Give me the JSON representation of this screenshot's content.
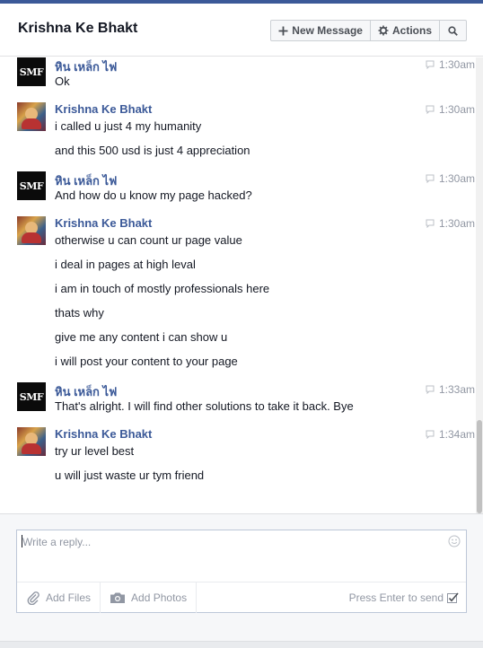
{
  "header": {
    "title": "Krishna Ke Bhakt",
    "new_message_label": "New Message",
    "actions_label": "Actions",
    "icons": {
      "new_message": "plus-icon",
      "actions": "gear-icon",
      "search": "search-icon"
    }
  },
  "messages": [
    {
      "sender": "หิน เหล็ก ไฟ",
      "avatar": "SMF",
      "time": "1:30am",
      "lines": [
        "Ok"
      ]
    },
    {
      "sender": "Krishna Ke Bhakt",
      "avatar": "krishna-avatar",
      "time": "1:30am",
      "lines": [
        "i called u just 4 my humanity",
        "and this 500 usd is just 4 appreciation"
      ]
    },
    {
      "sender": "หิน เหล็ก ไฟ",
      "avatar": "SMF",
      "time": "1:30am",
      "lines": [
        "And how do u know my page hacked?"
      ]
    },
    {
      "sender": "Krishna Ke Bhakt",
      "avatar": "krishna-avatar",
      "time": "1:30am",
      "lines": [
        "otherwise u can count ur  page value",
        "i deal in pages at high leval",
        "i am in touch of mostly professionals here",
        "thats why",
        "give me any content i can show u",
        "i will post your content to your page"
      ]
    },
    {
      "sender": "หิน เหล็ก ไฟ",
      "avatar": "SMF",
      "time": "1:33am",
      "lines": [
        "That's alright. I will find other solutions to take it back. Bye"
      ]
    },
    {
      "sender": "Krishna Ke Bhakt",
      "avatar": "krishna-avatar",
      "time": "1:34am",
      "lines": [
        "try ur level best",
        "u will just waste ur tym friend"
      ]
    }
  ],
  "composer": {
    "placeholder": "Write a reply...",
    "add_files_label": "Add Files",
    "add_photos_label": "Add Photos",
    "press_enter_label": "Press Enter to send"
  },
  "colors": {
    "accent": "#3b5998",
    "text": "#141823",
    "muted": "#9197a3"
  }
}
